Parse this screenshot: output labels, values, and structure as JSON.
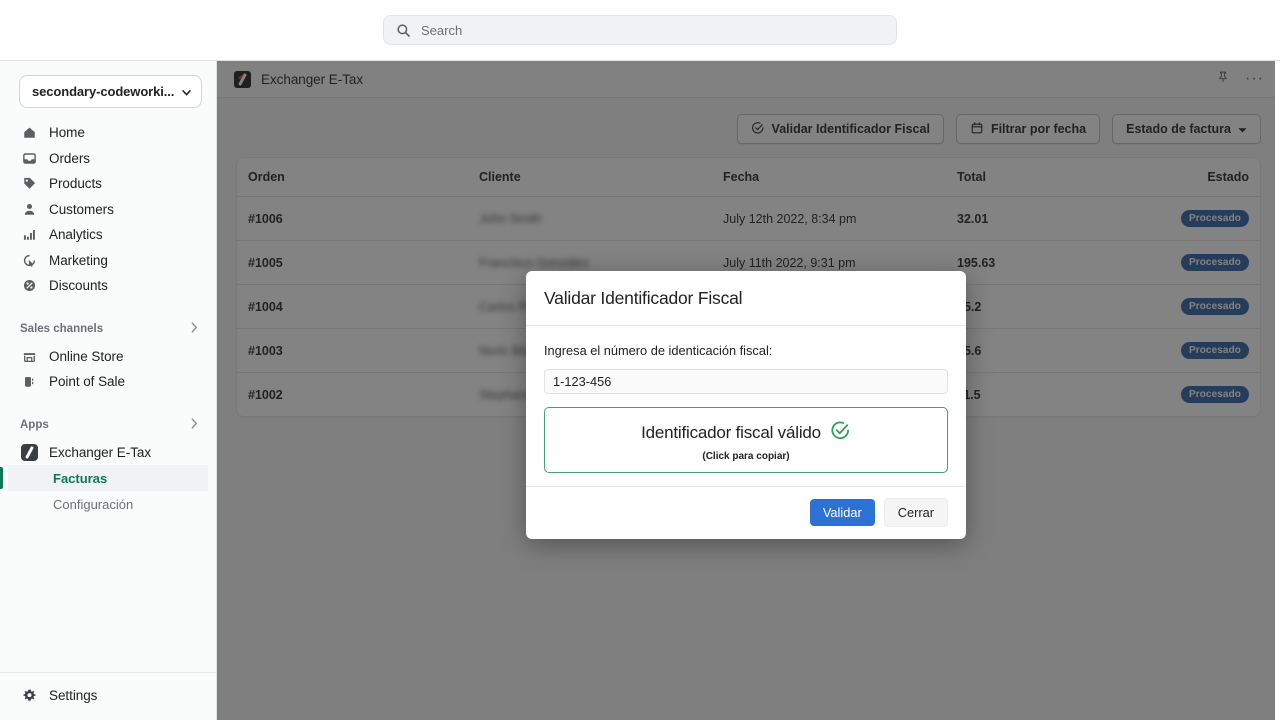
{
  "search": {
    "placeholder": "Search",
    "icon": "search-icon"
  },
  "sidebar": {
    "shop_switcher": {
      "label": "secondary-codeworki...",
      "icon": "chevron-down-icon"
    },
    "items": [
      {
        "label": "Home",
        "icon": "home-icon"
      },
      {
        "label": "Orders",
        "icon": "inbox-icon"
      },
      {
        "label": "Products",
        "icon": "tag-icon"
      },
      {
        "label": "Customers",
        "icon": "person-icon"
      },
      {
        "label": "Analytics",
        "icon": "bar-chart-icon"
      },
      {
        "label": "Marketing",
        "icon": "target-icon"
      },
      {
        "label": "Discounts",
        "icon": "discount-icon"
      }
    ],
    "sales_channels": {
      "title": "Sales channels",
      "chevron": "chevron-right-icon",
      "items": [
        {
          "label": "Online Store",
          "icon": "storefront-icon"
        },
        {
          "label": "Point of Sale",
          "icon": "pos-icon"
        }
      ]
    },
    "apps": {
      "title": "Apps",
      "chevron": "chevron-right-icon",
      "items": [
        {
          "label": "Exchanger E-Tax",
          "icon": "exchanger-app-icon"
        }
      ],
      "subitems": [
        {
          "label": "Facturas",
          "active": true
        },
        {
          "label": "Configuración",
          "active": false
        }
      ]
    },
    "footer": {
      "label": "Settings",
      "icon": "gear-icon"
    },
    "active_color": "#0e7a55"
  },
  "app_header": {
    "title": "Exchanger E-Tax",
    "icon": "exchanger-app-icon",
    "pin_icon": "pin-icon",
    "more_icon": "more-horizontal-icon"
  },
  "toolbar": {
    "buttons": [
      {
        "label": "Validar Identificador Fiscal",
        "icon": "circle-check-icon"
      },
      {
        "label": "Filtrar por fecha",
        "icon": "calendar-icon"
      },
      {
        "label": "Estado de factura",
        "icon": "chevron-down-icon"
      }
    ]
  },
  "table": {
    "columns": [
      "Orden",
      "Cliente",
      "Fecha",
      "Total",
      "Estado"
    ],
    "rows": [
      {
        "orden": "#1006",
        "cliente": "John Smith",
        "fecha": "July 12th 2022, 8:34 pm",
        "total": "32.01",
        "estado": "Procesado"
      },
      {
        "orden": "#1005",
        "cliente": "Francisco González",
        "fecha": "July 11th 2022, 9:31 pm",
        "total": "195.63",
        "estado": "Procesado"
      },
      {
        "orden": "#1004",
        "cliente": "Carlos Pérez",
        "fecha": "",
        "total": "45.2",
        "estado": "Procesado"
      },
      {
        "orden": "#1003",
        "cliente": "Noris Blanco",
        "fecha": "",
        "total": "85.6",
        "estado": "Procesado"
      },
      {
        "orden": "#1002",
        "cliente": "Stephanie Lee",
        "fecha": "",
        "total": "11.5",
        "estado": "Procesado"
      }
    ],
    "badge_color": "#2c5ea5"
  },
  "modal": {
    "title": "Validar Identificador Fiscal",
    "field_label": "Ingresa el número de identicación fiscal:",
    "field_value": "1-123-456",
    "result_text": "Identificador fiscal válido",
    "result_hint": "(Click para copiar)",
    "result_icon": "circle-check-icon",
    "result_color": "#4aa06a",
    "primary_button": "Validar",
    "secondary_button": "Cerrar",
    "primary_color": "#2d72d2"
  }
}
